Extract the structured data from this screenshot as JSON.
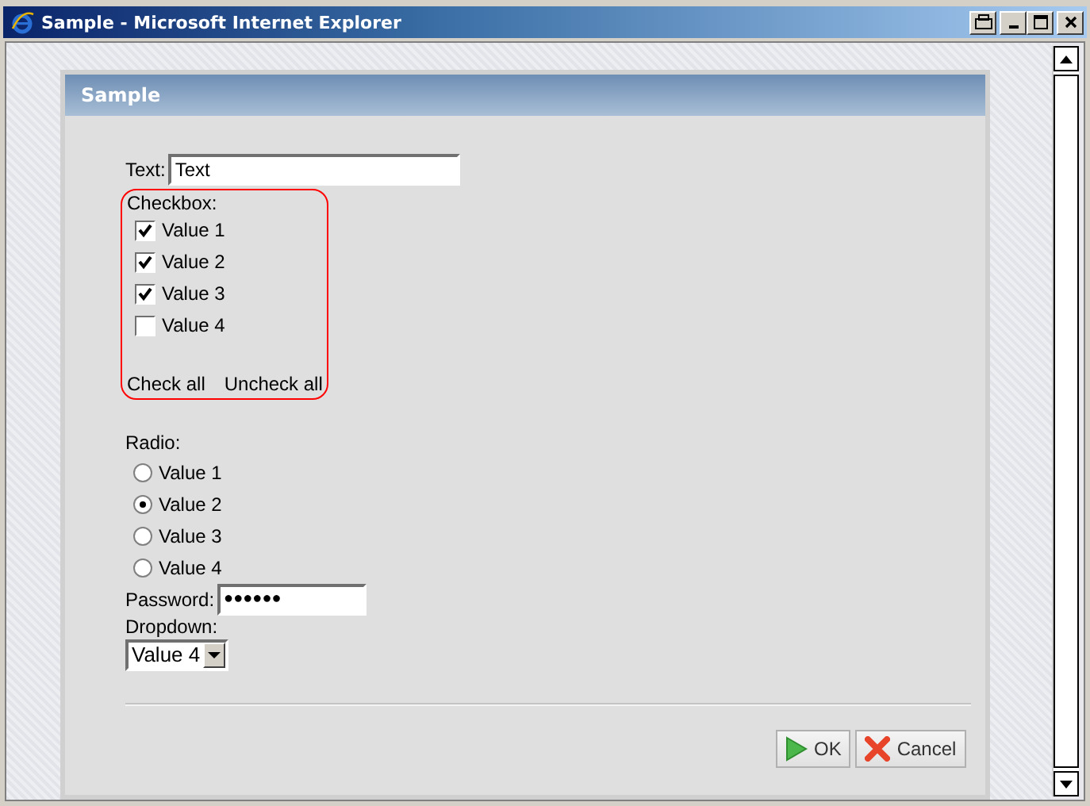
{
  "window": {
    "title": "Sample - Microsoft Internet Explorer"
  },
  "panel": {
    "title": "Sample"
  },
  "text_field": {
    "label": "Text:",
    "value": "Text"
  },
  "checkbox_group": {
    "label": "Checkbox:",
    "items": [
      {
        "label": "Value 1",
        "checked": true
      },
      {
        "label": "Value 2",
        "checked": true
      },
      {
        "label": "Value 3",
        "checked": true
      },
      {
        "label": "Value 4",
        "checked": false
      }
    ],
    "links": [
      "Check all",
      "Uncheck all"
    ]
  },
  "radio_group": {
    "label": "Radio:",
    "items": [
      {
        "label": "Value 1",
        "selected": false
      },
      {
        "label": "Value 2",
        "selected": true
      },
      {
        "label": "Value 3",
        "selected": false
      },
      {
        "label": "Value 4",
        "selected": false
      }
    ]
  },
  "password_field": {
    "label": "Password:",
    "value": "●●●●●●"
  },
  "dropdown": {
    "label": "Dropdown:",
    "value": "Value 4"
  },
  "buttons": [
    {
      "kind": "ok",
      "label": "OK"
    },
    {
      "kind": "cancel",
      "label": "Cancel"
    }
  ]
}
